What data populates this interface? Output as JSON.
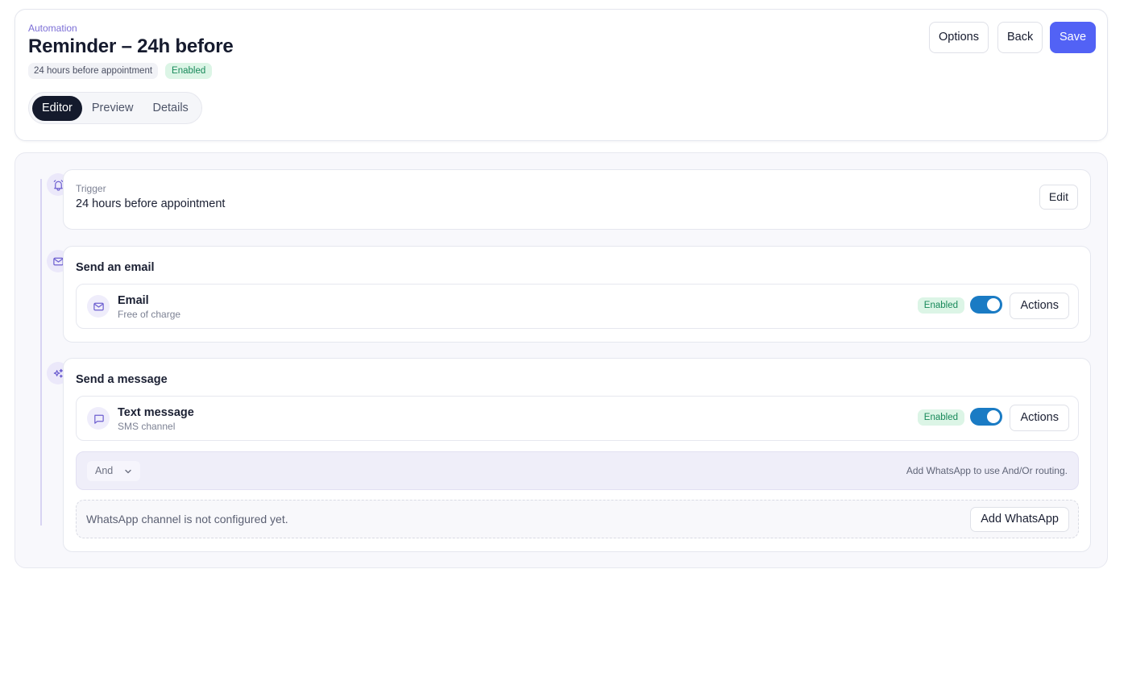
{
  "header": {
    "eyebrow": "Automation",
    "title": "Reminder – 24h before",
    "timing_chip": "24 hours before appointment",
    "status_chip": "Enabled",
    "tabs": [
      {
        "label": "Editor",
        "active": true
      },
      {
        "label": "Preview",
        "active": false
      },
      {
        "label": "Details",
        "active": false
      }
    ],
    "buttons": {
      "options": "Options",
      "back": "Back",
      "save": "Save"
    }
  },
  "flow": {
    "trigger": {
      "icon": "alarm-bell-icon",
      "label": "Trigger",
      "value": "24 hours before appointment",
      "edit_label": "Edit"
    },
    "email_step": {
      "icon": "mail-icon",
      "title": "Send an email",
      "channel": {
        "icon": "mail-icon",
        "name": "Email",
        "subtitle": "Free of charge",
        "status": "Enabled",
        "enabled": true,
        "actions_label": "Actions"
      }
    },
    "message_step": {
      "icon": "sparkles-icon",
      "title": "Send a message",
      "channel": {
        "icon": "chat-bubble-icon",
        "name": "Text message",
        "subtitle": "SMS channel",
        "status": "Enabled",
        "enabled": true,
        "actions_label": "Actions"
      },
      "routing": {
        "operator": "And",
        "hint": "Add WhatsApp to use And/Or routing."
      },
      "whatsapp": {
        "notice": "WhatsApp channel is not configured yet.",
        "button_label": "Add WhatsApp"
      }
    }
  },
  "colors": {
    "accent": "#5262f5",
    "toggle_on": "#1a7bc4",
    "enabled_bg": "#dcf5e6",
    "enabled_text": "#18895a",
    "timeline": "#d8d4f2"
  }
}
